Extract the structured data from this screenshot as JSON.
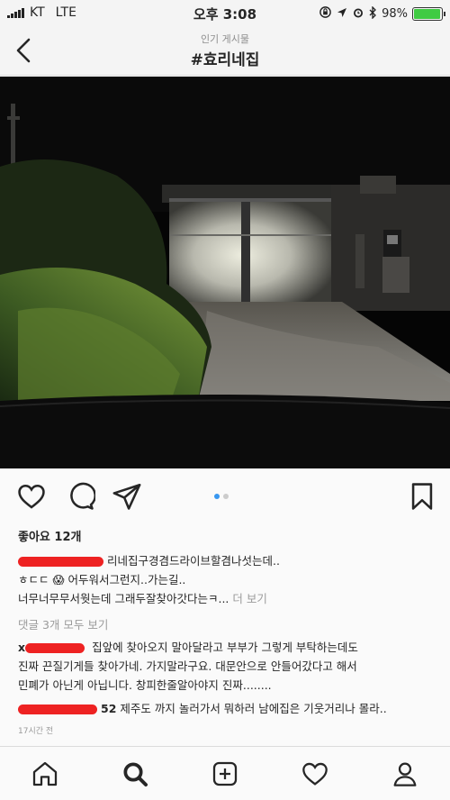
{
  "status_bar": {
    "carrier": "KT",
    "network": "LTE",
    "time": "오후 3:08",
    "battery": "98%",
    "battery_level": 0.98
  },
  "nav": {
    "subtitle": "인기 게시물",
    "title": "#효리네집"
  },
  "photo": {
    "description_icon": "night-gate-photo"
  },
  "carousel": {
    "count": 2,
    "active": 0
  },
  "post": {
    "likes": "좋아요 12개",
    "comments": [
      {
        "text": "리네집구경겸드라이브할겸나섯는데.."
      },
      {
        "user": "ㅎㄷㄷ",
        "emoji": "😱",
        "text": "어두워서그런지..가는길.."
      },
      {
        "text": "너무너무무서웟는데 그래두잘찾아갓다는ㅋ...",
        "more": "더 보기"
      }
    ],
    "view_all": "댓글 3개 모두 보기",
    "replies": [
      {
        "user_prefix": "x",
        "text_line1": "집앞에 찾아오지 말아달라고 부부가 그렇게 부탁하는데도",
        "text_line2": "진짜 끈질기게들 찾아가네. 가지말라구요. 대문안으로 안들어갔다고 해서",
        "text_line3": "민폐가 아닌게 아닙니다. 창피한줄알아야지 진짜........"
      },
      {
        "user_suffix": "52",
        "text": "제주도 까지 놀러가서 뭐하러 남에집은 기웃거리나 몰라.."
      }
    ],
    "time_ago": "17시간 전"
  },
  "colors": {
    "accent": "#3897f0",
    "redaction": "#ee2222",
    "battery": "#3fcb43"
  }
}
